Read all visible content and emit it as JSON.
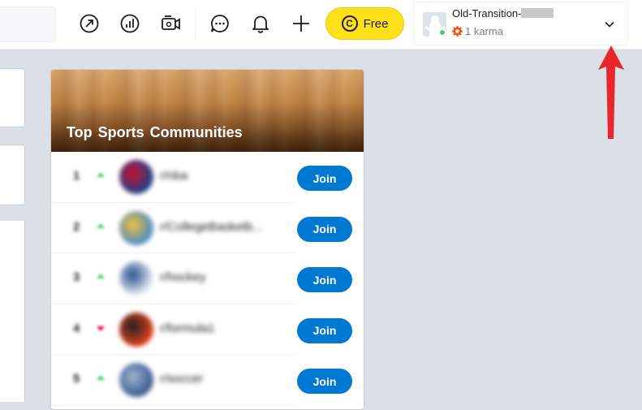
{
  "header": {
    "icons": [
      "popular-icon",
      "stats-icon",
      "coins-video-icon",
      "chat-icon",
      "notification-bell-icon",
      "create-post-icon"
    ],
    "premium_button_label": "Free",
    "coin_glyph": "C",
    "brand_yellow": "#ffe019"
  },
  "user_menu": {
    "username": "Old-Transition-",
    "karma": "1 karma",
    "online_color": "#46d160",
    "karma_color": "#ff4500"
  },
  "annotation": {
    "arrow_color": "#e8262b"
  },
  "widget": {
    "title": "Top Sports Communities",
    "join_label": "Join",
    "accent": "#0079d3",
    "rows": [
      {
        "rank": "1",
        "trend": "up",
        "name": "r/nba",
        "icon_color": "#1d428a",
        "icon_accent": "#c8102e"
      },
      {
        "rank": "2",
        "trend": "up",
        "name": "r/CollegeBasketb...",
        "icon_color": "#4a8bc2",
        "icon_accent": "#f0c040"
      },
      {
        "rank": "3",
        "trend": "up",
        "name": "r/hockey",
        "icon_color": "#e8eef4",
        "icon_accent": "#2a4f8f"
      },
      {
        "rank": "4",
        "trend": "down",
        "name": "r/formula1",
        "icon_color": "#e0401a",
        "icon_accent": "#222222"
      },
      {
        "rank": "5",
        "trend": "up",
        "name": "r/soccer",
        "icon_color": "#3a5a8f",
        "icon_accent": "#9fb3cf"
      }
    ]
  }
}
